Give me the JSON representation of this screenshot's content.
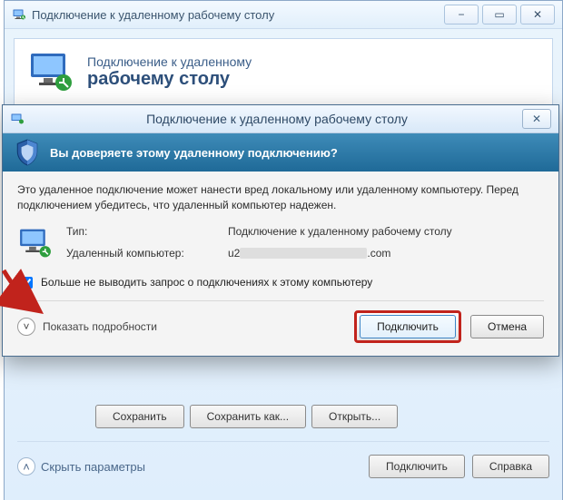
{
  "mainWindow": {
    "title": "Подключение к удаленному рабочему столу",
    "banner_line1": "Подключение к удаленному",
    "banner_line2": "рабочему столу",
    "btn_save": "Сохранить",
    "btn_save_as": "Сохранить как...",
    "btn_open": "Открыть...",
    "footer_collapse": "Скрыть параметры",
    "footer_connect": "Подключить",
    "footer_help": "Справка"
  },
  "dialog": {
    "title": "Подключение к удаленному рабочему столу",
    "trust_question": "Вы доверяете этому удаленному подключению?",
    "warn_text": "Это удаленное подключение может нанести вред локальному или удаленному компьютеру. Перед подключением убедитесь, что удаленный компьютер надежен.",
    "labels": {
      "type": "Тип:",
      "remote_computer": "Удаленный компьютер:"
    },
    "values": {
      "type": "Подключение к удаленному рабочему столу",
      "remote_prefix": "u2",
      "remote_suffix": ".com"
    },
    "checkbox_label": "Больше не выводить запрос о подключениях к этому компьютеру",
    "details_label": "Показать подробности",
    "btn_connect": "Подключить",
    "btn_cancel": "Отмена"
  },
  "icons": {
    "minimize": "−",
    "maximize": "▭",
    "close": "✕",
    "chevron_up": "˄",
    "chevron_down": "˅"
  },
  "colors": {
    "highlight_border": "#c1231c",
    "trustbar_grad_a": "#3e8bb8",
    "trustbar_grad_b": "#1f6a98"
  }
}
